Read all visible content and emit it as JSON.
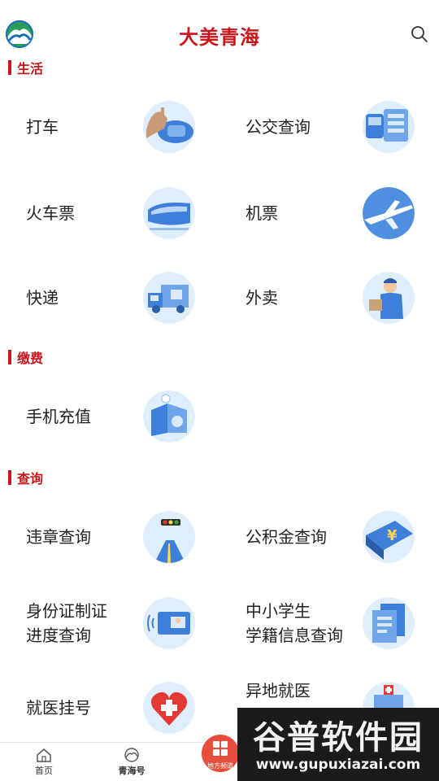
{
  "header": {
    "app_title": "大美青海",
    "logo_icon": "qinghai-logo-icon",
    "search_icon": "search-icon"
  },
  "sections": {
    "life": {
      "title": "生活"
    },
    "payment": {
      "title": "缴费"
    },
    "query": {
      "title": "查询"
    }
  },
  "services": {
    "taxi": {
      "label": "打车",
      "icon": "taxi-hand-icon"
    },
    "bus": {
      "label": "公交查询",
      "icon": "bus-icon"
    },
    "train": {
      "label": "火车票",
      "icon": "train-icon"
    },
    "flight": {
      "label": "机票",
      "icon": "airplane-icon"
    },
    "express": {
      "label": "快递",
      "icon": "delivery-truck-icon"
    },
    "takeout": {
      "label": "外卖",
      "icon": "food-delivery-icon"
    },
    "mobile_topup": {
      "label": "手机充值",
      "icon": "phone-recharge-icon"
    },
    "traffic_violation": {
      "label": "违章查询",
      "icon": "traffic-light-icon"
    },
    "housing_fund": {
      "label": "公积金查询",
      "icon": "yuan-wallet-icon"
    },
    "id_card": {
      "label": "身份证制证\n进度查询",
      "icon": "id-card-icon"
    },
    "student_record": {
      "label": "中小学生\n学籍信息查询",
      "icon": "student-docs-icon"
    },
    "hospital_reg": {
      "label": "就医挂号",
      "icon": "medical-heart-icon"
    },
    "remote_medical": {
      "label": "异地就医",
      "icon": "hospital-icon"
    }
  },
  "bottom_nav": {
    "home": {
      "label": "首页",
      "icon": "home-icon"
    },
    "qinghai_hao": {
      "label": "青海号",
      "icon": "qinghai-logo-icon"
    },
    "local_channel": {
      "label": "地方频道",
      "icon": "grid-icon"
    }
  },
  "watermark": {
    "main": "谷普软件园",
    "url": "www.gupuxiazai.com"
  },
  "colors": {
    "brand_red": "#c8161d",
    "icon_blue": "#3d7fd9",
    "icon_bg": "#e8f1fb"
  }
}
